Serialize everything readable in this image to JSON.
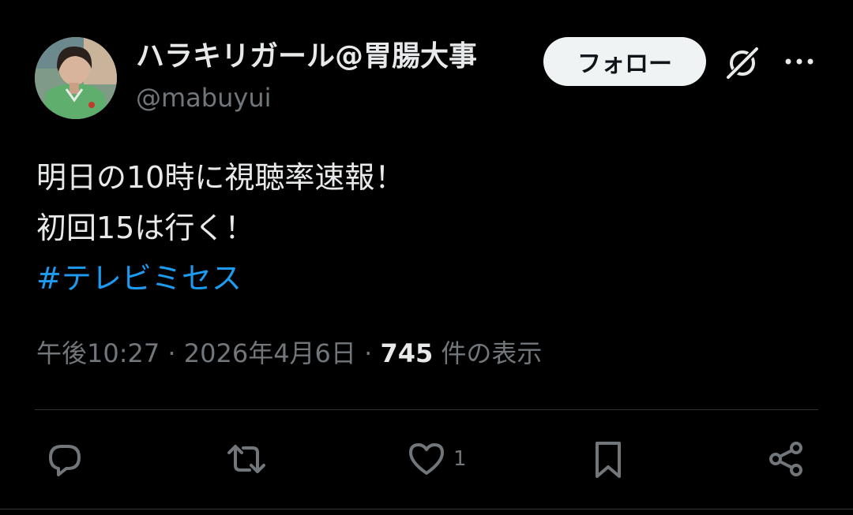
{
  "author": {
    "display_name": "ハラキリガール@胃腸大事",
    "handle": "@mabuyui"
  },
  "header": {
    "follow_label": "フォロー",
    "grok_icon": "grok-icon",
    "more_icon": "more-dots-icon"
  },
  "tweet": {
    "lines": [
      "明日の10時に視聴率速報！",
      "初回15は行く！"
    ],
    "hashtag": "#テレビミセス"
  },
  "meta": {
    "time": "午後10:27",
    "separator": "·",
    "date": "2026年4月6日",
    "views": "745",
    "views_suffix": "件の表示"
  },
  "actions": {
    "reply_icon": "reply-icon",
    "retweet_icon": "retweet-icon",
    "like_icon": "like-icon",
    "like_count": "1",
    "bookmark_icon": "bookmark-icon",
    "share_icon": "share-icon"
  },
  "colors": {
    "background": "#000000",
    "text": "#e7e9ea",
    "secondary": "#71767b",
    "hashtag": "#1d9bf0",
    "divider": "#2f3336",
    "follow_bg": "#eff3f4"
  }
}
